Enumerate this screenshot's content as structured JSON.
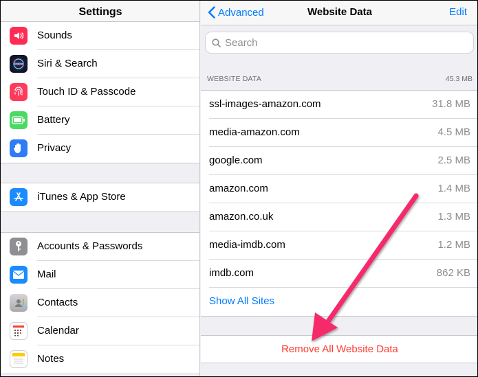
{
  "settings": {
    "title": "Settings",
    "group1": [
      {
        "label": "Sounds",
        "icon": "sounds-icon",
        "color": "#ff2d55"
      },
      {
        "label": "Siri & Search",
        "icon": "siri-icon",
        "color": "#1c1c2e"
      },
      {
        "label": "Touch ID & Passcode",
        "icon": "fingerprint-icon",
        "color": "#ff3b5c"
      },
      {
        "label": "Battery",
        "icon": "battery-icon",
        "color": "#4cd964"
      },
      {
        "label": "Privacy",
        "icon": "hand-icon",
        "color": "#2f7cf6"
      }
    ],
    "group2": [
      {
        "label": "iTunes & App Store",
        "icon": "app-store-icon",
        "color": "#1a8cff"
      }
    ],
    "group3": [
      {
        "label": "Accounts & Passwords",
        "icon": "key-icon",
        "color": "#8e8e93"
      },
      {
        "label": "Mail",
        "icon": "mail-icon",
        "color": "#1a8cff"
      },
      {
        "label": "Contacts",
        "icon": "contacts-icon",
        "color": "#b8b8bd"
      },
      {
        "label": "Calendar",
        "icon": "calendar-icon",
        "color": "#ffffff"
      },
      {
        "label": "Notes",
        "icon": "notes-icon",
        "color": "#ffffff"
      }
    ]
  },
  "website_data": {
    "back_label": "Advanced",
    "title": "Website Data",
    "edit_label": "Edit",
    "search_placeholder": "Search",
    "section_header": "WEBSITE DATA",
    "total_size": "45.3 MB",
    "sites": [
      {
        "name": "ssl-images-amazon.com",
        "size": "31.8 MB"
      },
      {
        "name": "media-amazon.com",
        "size": "4.5 MB"
      },
      {
        "name": "google.com",
        "size": "2.5 MB"
      },
      {
        "name": "amazon.com",
        "size": "1.4 MB"
      },
      {
        "name": "amazon.co.uk",
        "size": "1.3 MB"
      },
      {
        "name": "media-imdb.com",
        "size": "1.2 MB"
      },
      {
        "name": "imdb.com",
        "size": "862 KB"
      }
    ],
    "show_all_label": "Show All Sites",
    "remove_all_label": "Remove All Website Data"
  },
  "colors": {
    "accent": "#007aff",
    "destructive": "#ff3b30",
    "annotation_arrow": "#f5296b"
  }
}
